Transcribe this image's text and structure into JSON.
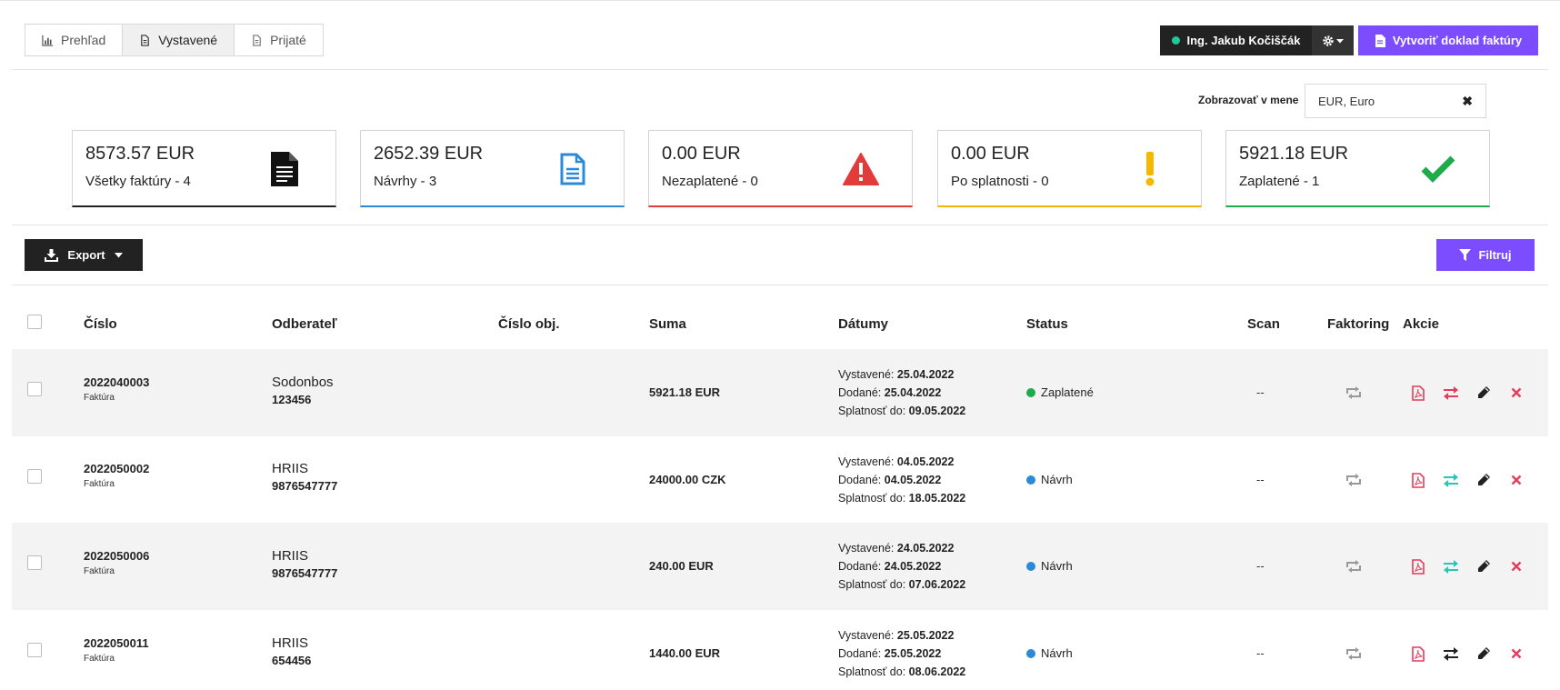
{
  "tabs": [
    {
      "label": "Prehľad",
      "icon": "bar-chart-icon",
      "active": false
    },
    {
      "label": "Vystavené",
      "icon": "document-icon",
      "active": true
    },
    {
      "label": "Prijaté",
      "icon": "document-icon",
      "active": false
    }
  ],
  "header": {
    "user_name": "Ing. Jakub Kočiščák",
    "create_label": "Vytvoriť doklad faktúry"
  },
  "currency": {
    "label": "Zobrazovať v mene",
    "value": "EUR, Euro",
    "clear": "✖"
  },
  "cards": [
    {
      "amount": "8573.57 EUR",
      "label": "Všetky faktúry - 4",
      "color": "#222222"
    },
    {
      "amount": "2652.39 EUR",
      "label": "Návrhy - 3",
      "color": "#2b8ad8"
    },
    {
      "amount": "0.00 EUR",
      "label": "Nezaplatené - 0",
      "color": "#e23b3b"
    },
    {
      "amount": "0.00 EUR",
      "label": "Po splatnosti - 0",
      "color": "#f2b20a"
    },
    {
      "amount": "5921.18 EUR",
      "label": "Zaplatené - 1",
      "color": "#1fab4b"
    }
  ],
  "toolbar": {
    "export_label": "Export",
    "filter_label": "Filtruj"
  },
  "table": {
    "headers": {
      "number": "Číslo",
      "customer": "Odberateľ",
      "order": "Číslo obj.",
      "sum": "Suma",
      "dates": "Dátumy",
      "status": "Status",
      "scan": "Scan",
      "factoring": "Faktoring",
      "actions": "Akcie"
    },
    "date_labels": {
      "issued": "Vystavené:",
      "delivered": "Dodané:",
      "due": "Splatnosť do:"
    },
    "rows": [
      {
        "number": "2022040003",
        "type": "Faktúra",
        "customer": "Sodonbos",
        "customer_id": "123456",
        "sum": "5921.18 EUR",
        "issued": "25.04.2022",
        "delivered": "25.04.2022",
        "due": "09.05.2022",
        "status": "Zaplatené",
        "status_color": "#1fab4b",
        "scan": "--"
      },
      {
        "number": "2022050002",
        "type": "Faktúra",
        "customer": "HRIIS",
        "customer_id": "9876547777",
        "sum": "24000.00 CZK",
        "issued": "04.05.2022",
        "delivered": "04.05.2022",
        "due": "18.05.2022",
        "status": "Návrh",
        "status_color": "#2b8ad8",
        "scan": "--"
      },
      {
        "number": "2022050006",
        "type": "Faktúra",
        "customer": "HRIIS",
        "customer_id": "9876547777",
        "sum": "240.00 EUR",
        "issued": "24.05.2022",
        "delivered": "24.05.2022",
        "due": "07.06.2022",
        "status": "Návrh",
        "status_color": "#2b8ad8",
        "scan": "--"
      },
      {
        "number": "2022050011",
        "type": "Faktúra",
        "customer": "HRIIS",
        "customer_id": "654456",
        "sum": "1440.00 EUR",
        "issued": "25.05.2022",
        "delivered": "25.05.2022",
        "due": "08.06.2022",
        "status": "Návrh",
        "status_color": "#2b8ad8",
        "scan": "--"
      }
    ]
  }
}
